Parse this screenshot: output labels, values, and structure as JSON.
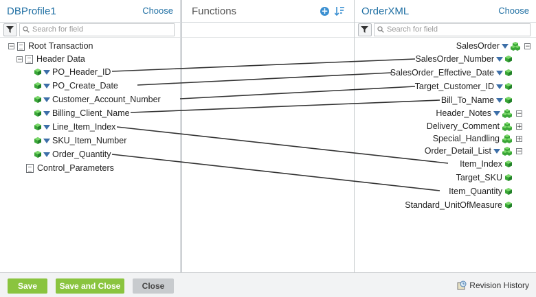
{
  "left_panel": {
    "title": "DBProfile1",
    "choose": "Choose",
    "search_placeholder": "Search for field",
    "tree": {
      "root": "Root Transaction",
      "header": "Header Data",
      "fields": [
        "PO_Header_ID",
        "PO_Create_Date",
        "Customer_Account_Number",
        "Billing_Client_Name",
        "Line_Item_Index",
        "SKU_Item_Number",
        "Order_Quantity"
      ],
      "control": "Control_Parameters"
    }
  },
  "middle_panel": {
    "title": "Functions"
  },
  "right_panel": {
    "title": "OrderXML",
    "choose": "Choose",
    "search_placeholder": "Search for field",
    "items": [
      {
        "label": "SalesOrder"
      },
      {
        "label": "SalesOrder_Number"
      },
      {
        "label": "SalesOrder_Effective_Date"
      },
      {
        "label": "Target_Customer_ID"
      },
      {
        "label": "Bill_To_Name"
      },
      {
        "label": "Header_Notes"
      },
      {
        "label": "Delivery_Comment"
      },
      {
        "label": "Special_Handling"
      },
      {
        "label": "Order_Detail_List"
      },
      {
        "label": "Item_Index"
      },
      {
        "label": "Target_SKU"
      },
      {
        "label": "Item_Quantity"
      },
      {
        "label": "Standard_UnitOfMeasure"
      }
    ]
  },
  "footer": {
    "save": "Save",
    "save_close": "Save and Close",
    "close": "Close",
    "revision_history": "Revision History"
  },
  "colors": {
    "accent_blue": "#1f6fa3",
    "button_green": "#8ac43f",
    "cube_green": "#3aa637",
    "mapping_line": "#333333"
  },
  "icons": {
    "expand": "plus-box-icon",
    "collapse": "minus-box-icon",
    "element": "green-cube-icon",
    "group": "cube-cluster-icon",
    "sort": "sort-icon",
    "add": "add-function-icon",
    "filter": "funnel-icon",
    "search": "search-icon",
    "revision": "revision-history-icon"
  }
}
